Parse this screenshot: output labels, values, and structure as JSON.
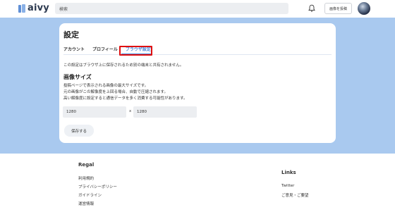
{
  "header": {
    "logo_text": "aivy",
    "search_placeholder": "検索",
    "post_button": "画像を投稿"
  },
  "settings": {
    "title": "設定",
    "tabs": [
      {
        "label": "アカウント",
        "active": false
      },
      {
        "label": "プロフィール",
        "active": false
      },
      {
        "label": "ブラウザ設定",
        "active": true
      }
    ],
    "notice": "この設定はブラウザ上に保存されるため別の端末と共有されません。",
    "image_size": {
      "title": "画像サイズ",
      "lines": [
        "投稿ページで表示される画像の最大サイズです。",
        "元の画像がこの解像度を上回る場合、自動で圧縮されます。",
        "高い解像度に設定すると通信データを多く消費する可能性があります。"
      ],
      "width_value": "1280",
      "height_value": "1280",
      "separator": "x"
    },
    "save_button": "保存する"
  },
  "footer": {
    "brand": "Regal",
    "brand_links": [
      "利用規約",
      "プライバシーポリシー",
      "ガイドライン",
      "運営情報"
    ],
    "links_heading": "Links",
    "links": [
      "Twitter",
      "ご意見・ご要望"
    ]
  },
  "colors": {
    "page_background": "#a9c9ef",
    "accent": "#4a86d8",
    "highlight": "#e01010"
  }
}
